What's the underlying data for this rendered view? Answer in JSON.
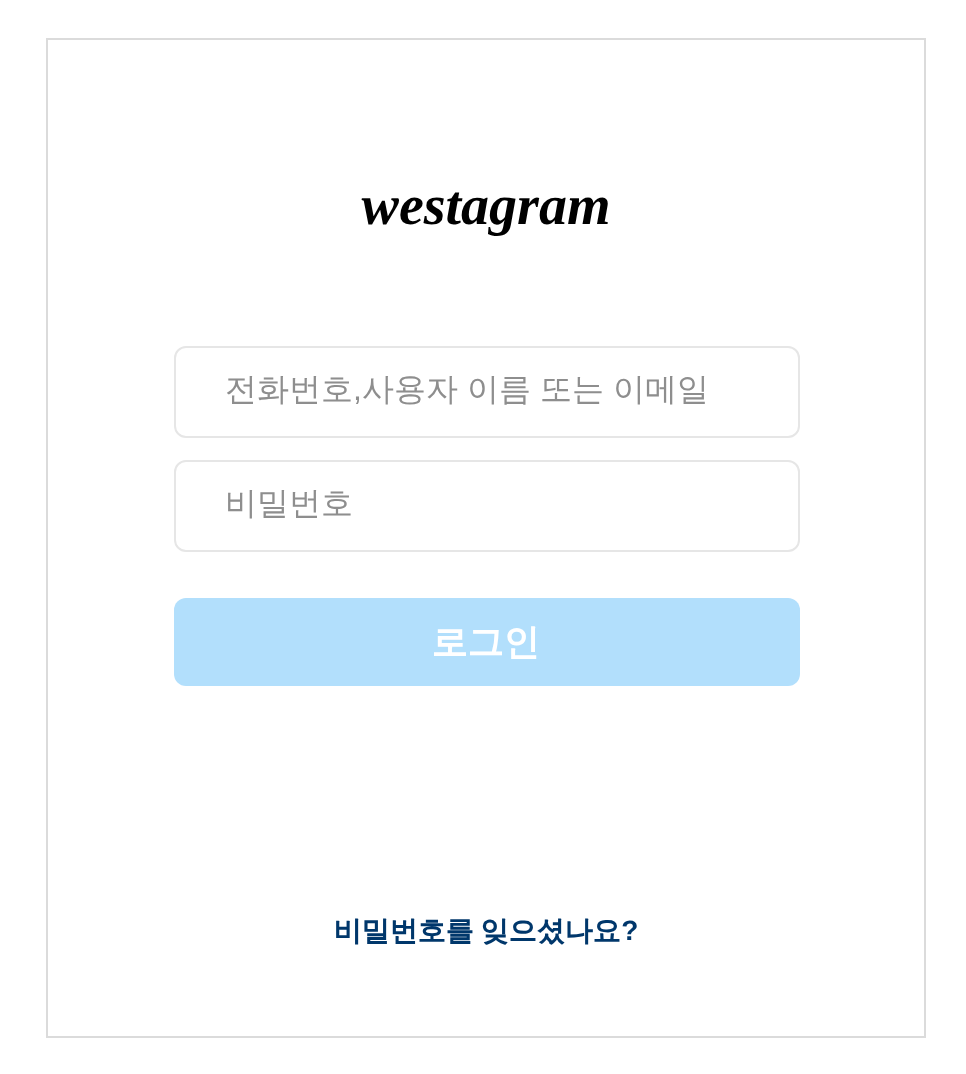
{
  "logo": "westagram",
  "fields": [
    {
      "placeholder": "전화번호,사용자 이름 또는 이메일"
    },
    {
      "placeholder": "비밀번호"
    }
  ],
  "login_button": {
    "label": "로그인",
    "disabled": true
  },
  "forgot_link": "비밀번호를 잊으셨나요?"
}
